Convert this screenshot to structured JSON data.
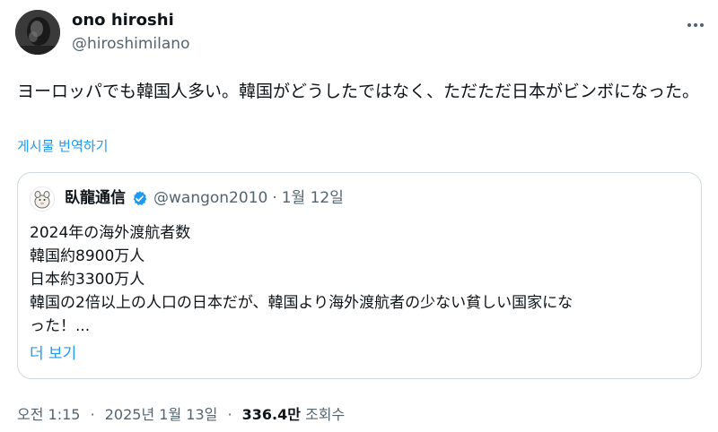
{
  "author": {
    "name": "ono hiroshi",
    "handle": "@hiroshimilano"
  },
  "tweet": {
    "text": "ヨーロッパでも韓国人多い。韓国がどうしたではなく、ただただ日本がビンボになった。",
    "translate_label": "게시물 번역하기"
  },
  "quote": {
    "name": "臥龍通信",
    "handle": "@wangon2010",
    "separator": "·",
    "date": "1월 12일",
    "lines": [
      "2024年の海外渡航者数",
      "韓国約8900万人",
      "日本約3300万人",
      "韓国の2倍以上の人口の日本だが、韓国より海外渡航者の少ない貧しい国家にな",
      "った！..."
    ],
    "show_more": "더 보기"
  },
  "meta": {
    "time": "오전 1:15",
    "separator": "·",
    "date": "2025년 1월 13일",
    "views_count": "336.4만",
    "views_label": "조회수"
  },
  "colors": {
    "text_primary": "#0f1419",
    "text_secondary": "#536471",
    "link_blue": "#1d9bf0",
    "border": "#cfd9de"
  },
  "icons": {
    "more": "more-dots-icon",
    "verified": "verified-badge-icon"
  }
}
